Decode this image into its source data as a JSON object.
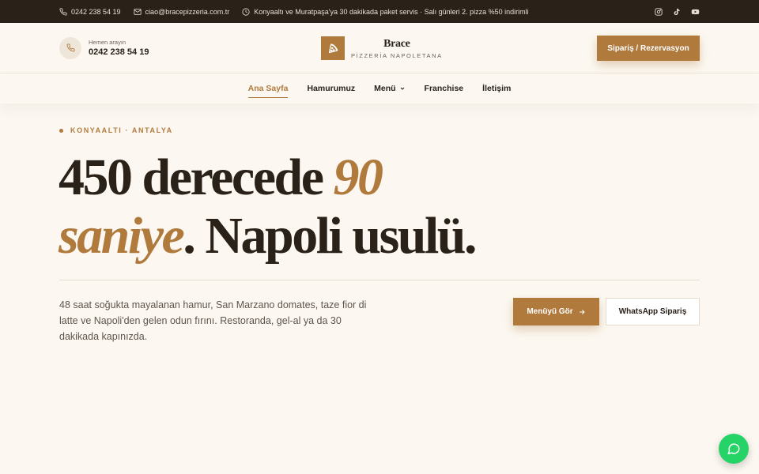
{
  "topbar": {
    "phone": "0242 238 54 19",
    "email": "ciao@bracepizzeria.com.tr",
    "notice": "Konyaaltı ve Muratpaşa'ya 30 dakikada paket servis · Salı günleri 2. pizza %50 indirimli",
    "socials": [
      "instagram-icon",
      "tiktok-icon",
      "youtube-icon"
    ]
  },
  "header": {
    "call_label": "Hemen arayın",
    "call_number": "0242 238 54 19",
    "logo_name": "Brace",
    "logo_tagline": "PİZZERİA NAPOLETANA",
    "order_label": "Sipariş / Rezervasyon"
  },
  "nav": {
    "items": [
      {
        "label": "Ana Sayfa",
        "active": true
      },
      {
        "label": "Hamurumuz",
        "active": false
      },
      {
        "label": "Menü",
        "active": false,
        "dropdown": true
      },
      {
        "label": "Franchise",
        "active": false
      },
      {
        "label": "İletişim",
        "active": false
      }
    ]
  },
  "hero": {
    "eyebrow": "KONYAALTI · ANTALYA",
    "title_part1": "450 derecede ",
    "title_accent1": "90",
    "title_accent2": "saniye",
    "title_part2": ". Napoli usulü.",
    "description": "48 saat soğukta mayalanan hamur, San Marzano domates, taze fior di latte ve Napoli'den gelen odun fırını. Restoranda, gel-al ya da 30 dakikada kapınızda.",
    "menu_button": "Menüyü Gör",
    "whatsapp_button": "WhatsApp Sipariş"
  },
  "colors": {
    "accent": "#b07a3d",
    "dark": "#2a2119",
    "background": "#fcf8f1",
    "whatsapp": "#25d366"
  }
}
